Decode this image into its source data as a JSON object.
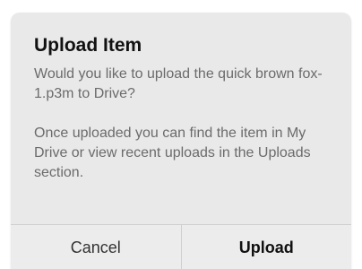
{
  "dialog": {
    "title": "Upload Item",
    "message_1": "Would you like to upload the quick brown fox-1.p3m to Drive?",
    "message_2": "Once uploaded you can find the item in My Drive or view recent uploads in the Uploads section.",
    "buttons": {
      "cancel_label": "Cancel",
      "upload_label": "Upload"
    }
  },
  "colors": {
    "dialog_background": "#e9e9e9",
    "title_text": "#111111",
    "message_text": "#6b6b6b",
    "divider": "#cfcfcf"
  }
}
